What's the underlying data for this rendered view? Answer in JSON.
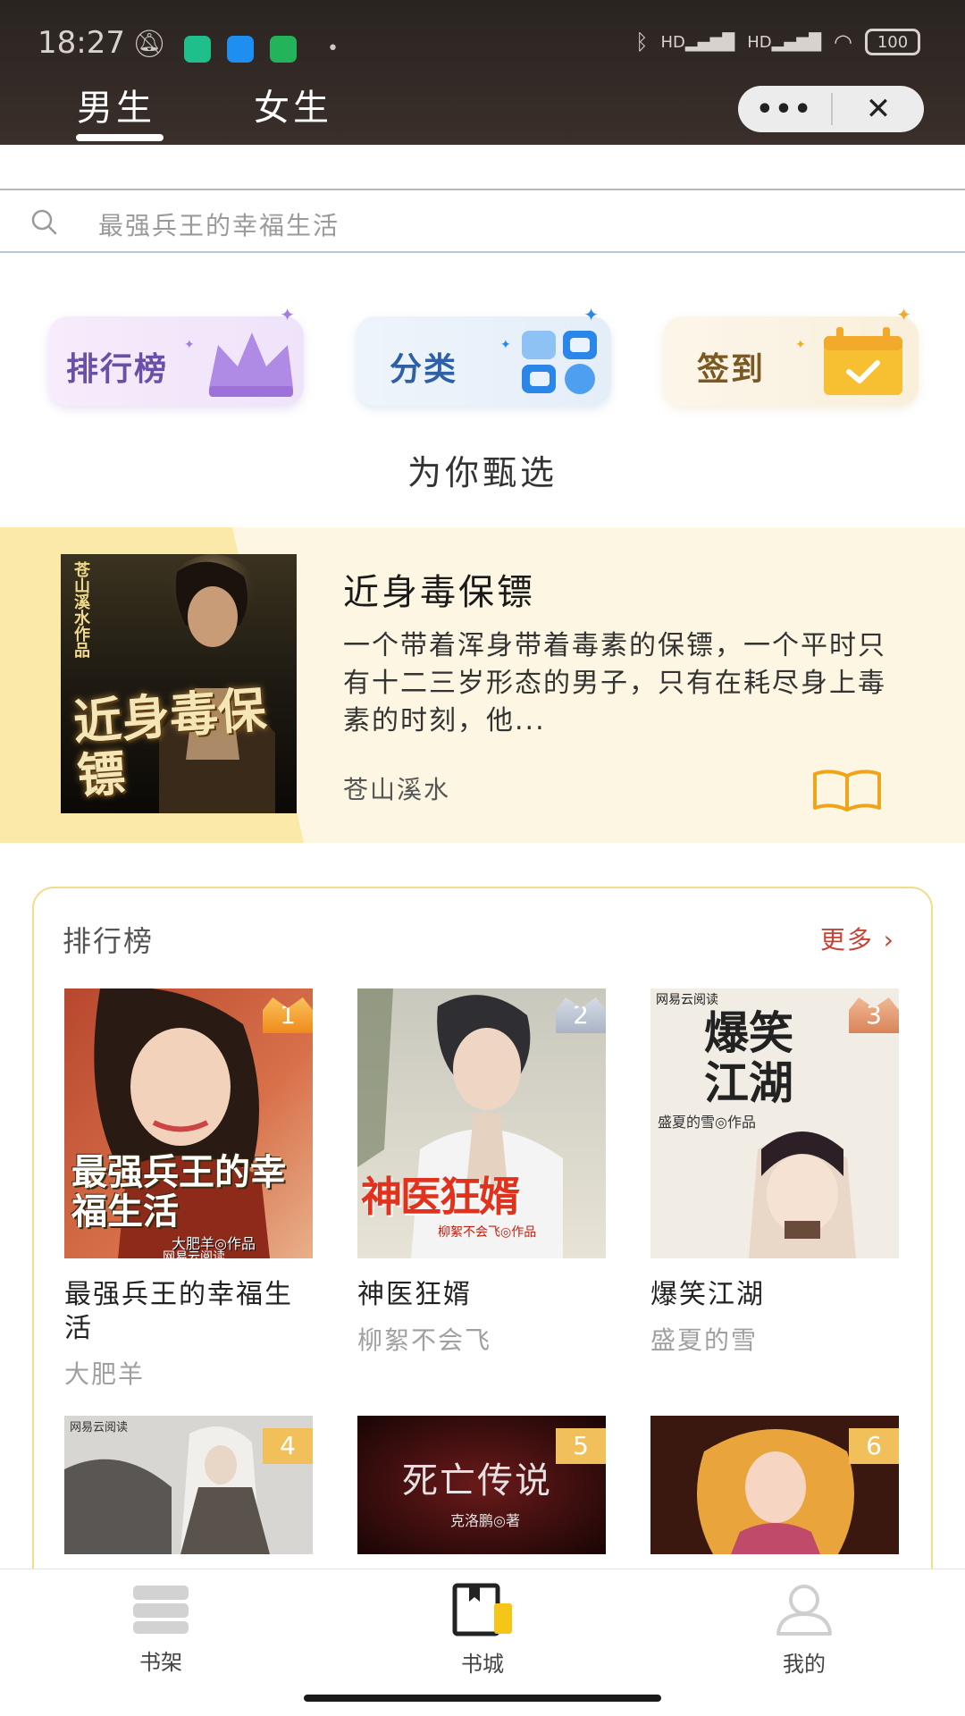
{
  "status_bar": {
    "time": "18:27",
    "battery": "100",
    "signal_labels": [
      "HD",
      "HD"
    ]
  },
  "header": {
    "tabs": [
      {
        "label": "男生",
        "active": true
      },
      {
        "label": "女生",
        "active": false
      }
    ],
    "capsule": {
      "more": "•••",
      "close": "✕"
    }
  },
  "search": {
    "placeholder": "最强兵王的幸福生活",
    "icon": "search-icon"
  },
  "quick_entries": [
    {
      "label": "排行榜",
      "icon": "crown-icon",
      "color": "#6a4fa8"
    },
    {
      "label": "分类",
      "icon": "category-grid-icon",
      "color": "#2f5fa7"
    },
    {
      "label": "签到",
      "icon": "calendar-check-icon",
      "color": "#7a5a22"
    }
  ],
  "section_title": "为你甄选",
  "featured": {
    "title": "近身毒保镖",
    "description": "一个带着浑身带着毒素的保镖，一个平时只有十二三岁形态的男子，只有在耗尽身上毒素的时刻，他...",
    "author": "苍山溪水",
    "cover_text": {
      "author_vertical": "苍山溪水作品",
      "title": "近身毒保镖"
    }
  },
  "ranking": {
    "heading": "排行榜",
    "more": "更多 ›",
    "books": [
      {
        "rank": "1",
        "title": "最强兵王的幸福生活",
        "author": "大肥羊",
        "cover_title": "最强兵王的幸福生活",
        "cover_sub": "大肥羊◎作品",
        "cover_pub": "网易云阅读"
      },
      {
        "rank": "2",
        "title": "神医狂婿",
        "author": "柳絮不会飞",
        "cover_title": "神医狂婿",
        "cover_sub": "柳絮不会飞◎作品"
      },
      {
        "rank": "3",
        "title": "爆笑江湖",
        "author": "盛夏的雪",
        "cover_title": "爆笑江湖",
        "cover_sub": "盛夏的雪◎作品",
        "cover_pub": "网易云阅读"
      },
      {
        "rank": "4",
        "cover_pub": "网易云阅读"
      },
      {
        "rank": "5",
        "cover_title": "死亡传说",
        "cover_sub": "克洛鹏◎著"
      },
      {
        "rank": "6"
      }
    ]
  },
  "bottom_nav": [
    {
      "label": "书架",
      "icon": "bookshelf-icon"
    },
    {
      "label": "书城",
      "icon": "bookstore-icon",
      "active": true
    },
    {
      "label": "我的",
      "icon": "user-icon"
    }
  ]
}
